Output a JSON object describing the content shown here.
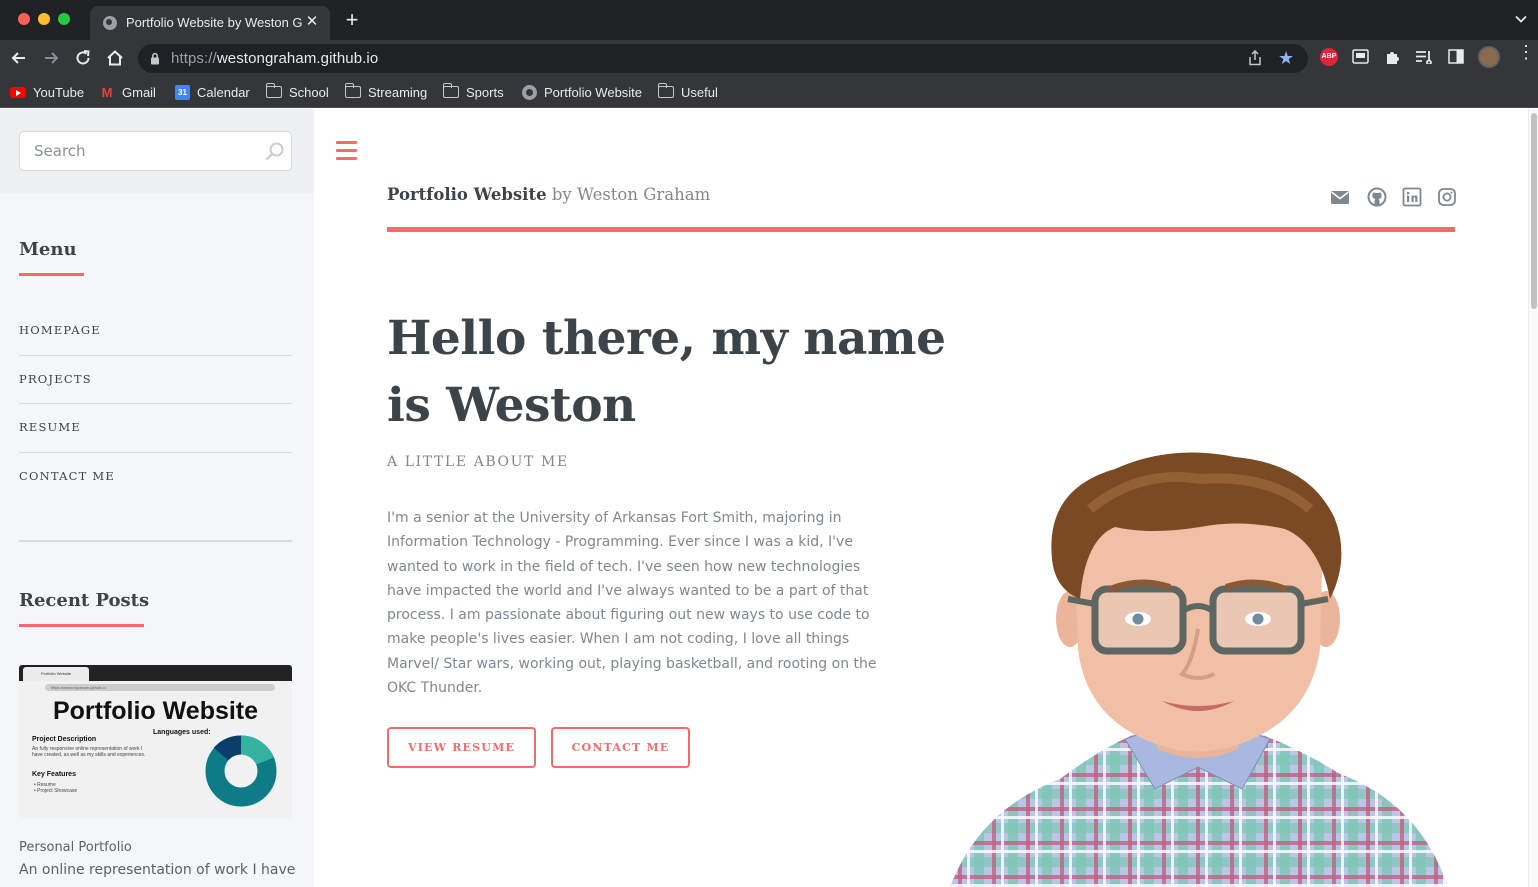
{
  "browser": {
    "tab_title": "Portfolio Website by Weston Graham",
    "tab_close": "✕",
    "new_tab": "+",
    "url_scheme": "https://",
    "url_host": "westongraham.github.io",
    "abp_label": "ABP",
    "bookmarks": [
      {
        "label": "YouTube",
        "icon": "youtube-icon"
      },
      {
        "label": "Gmail",
        "icon": "gmail-icon"
      },
      {
        "label": "Calendar",
        "icon": "calendar-icon"
      },
      {
        "label": "School",
        "icon": "folder-icon"
      },
      {
        "label": "Streaming",
        "icon": "folder-icon"
      },
      {
        "label": "Sports",
        "icon": "folder-icon"
      },
      {
        "label": "Portfolio Website",
        "icon": "globe-icon"
      },
      {
        "label": "Useful",
        "icon": "folder-icon"
      }
    ],
    "gmail_glyph": "M",
    "calendar_glyph": "31"
  },
  "sidebar": {
    "search_placeholder": "Search",
    "menu_heading": "Menu",
    "menu_items": [
      {
        "label": "HOMEPAGE"
      },
      {
        "label": "PROJECTS"
      },
      {
        "label": "RESUME"
      },
      {
        "label": "CONTACT ME"
      }
    ],
    "recent_heading": "Recent Posts",
    "post_thumb": {
      "tab": "Portfolio Website",
      "url": "https://westongraham.github.io",
      "title": "Portfolio Website",
      "desc_heading": "Project Description",
      "desc_text": "An fully responsive online representation of work I have created, as well as my skills and experiences.",
      "features_heading": "Key Features",
      "features": [
        "• Resume",
        "• Project Showcase"
      ],
      "languages_heading": "Languages used:"
    },
    "post_title": "Personal Portfolio",
    "post_desc": "An online representation of work I have"
  },
  "header": {
    "site_name": "Portfolio Website",
    "by_text": " by Weston Graham",
    "socials": [
      "envelope-icon",
      "github-icon",
      "linkedin-icon",
      "instagram-icon"
    ]
  },
  "hero": {
    "heading": "Hello there, my name is Weston",
    "subheading": "A LITTLE ABOUT ME",
    "body": "I'm a senior at the University of Arkansas Fort Smith, majoring in Information Technology - Programming. Ever since I was a kid, I've wanted to work in the field of tech. I've seen how new technologies have impacted the world and I've always wanted to be a part of that process. I am passionate about figuring out new ways to use code to make people's lives easier. When I am not coding, I love all things Marvel/ Star wars, working out, playing basketball, and rooting on the OKC Thunder.",
    "buttons": [
      {
        "label": "VIEW RESUME"
      },
      {
        "label": "CONTACT ME"
      }
    ]
  },
  "colors": {
    "accent": "#f56a6a",
    "heading": "#3d4449",
    "body_text": "#7f888f",
    "sidebar_bg": "#f5f6f7"
  }
}
